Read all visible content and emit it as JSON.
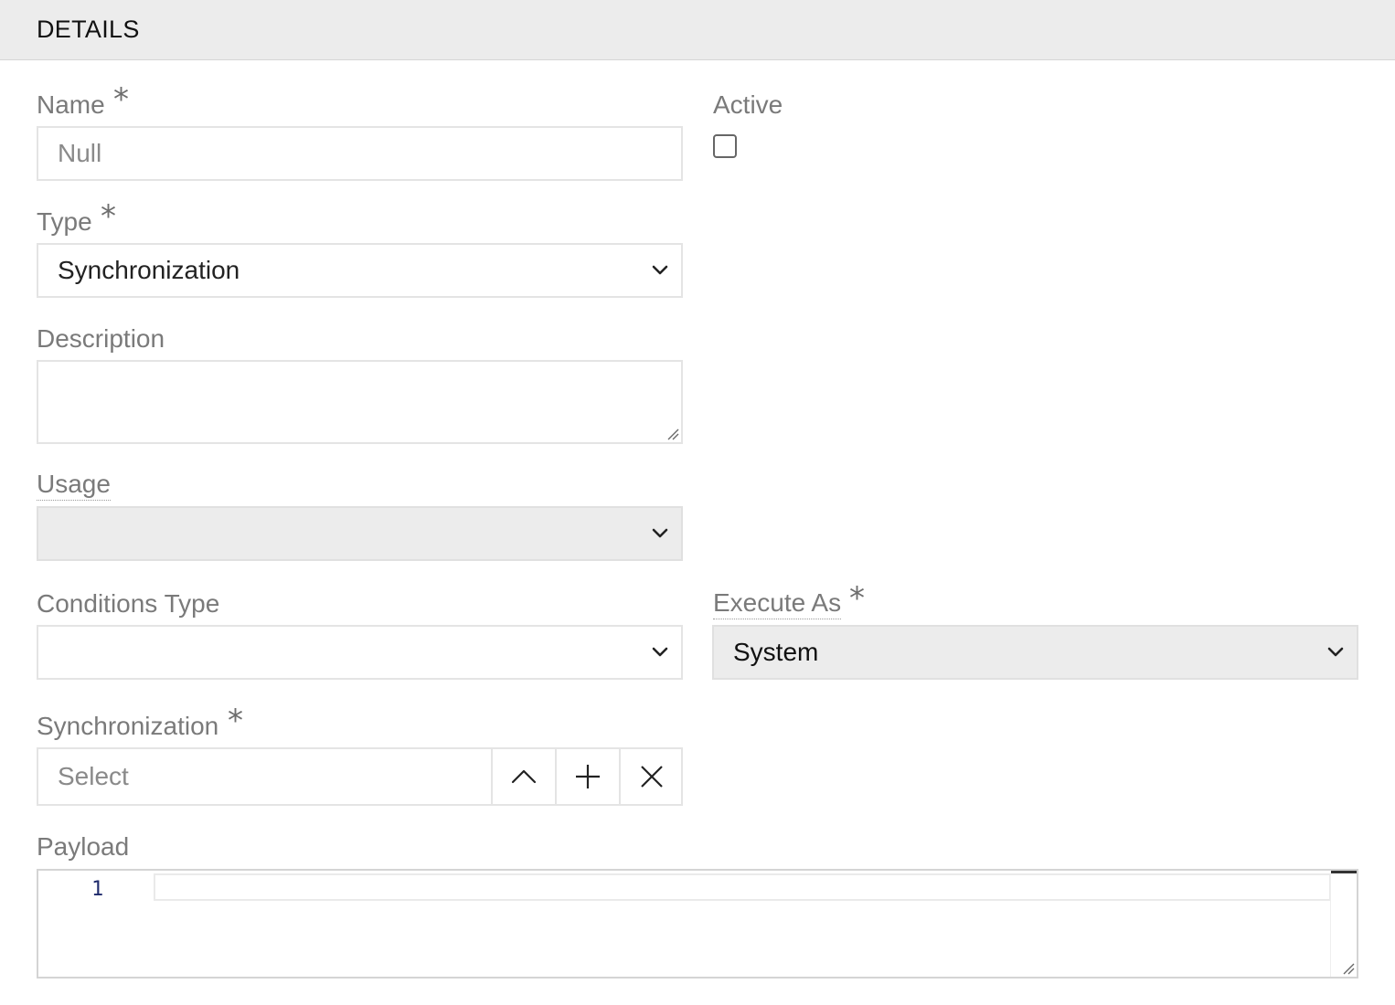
{
  "header": {
    "title": "DETAILS"
  },
  "fields": {
    "name": {
      "label": "Name",
      "required_mark": "*",
      "placeholder": "Null",
      "value": ""
    },
    "active": {
      "label": "Active",
      "checked": false
    },
    "type": {
      "label": "Type",
      "required_mark": "*",
      "selected": "Synchronization"
    },
    "description": {
      "label": "Description",
      "value": ""
    },
    "usage": {
      "label": "Usage",
      "selected": ""
    },
    "conditions_type": {
      "label": "Conditions Type",
      "selected": ""
    },
    "execute_as": {
      "label": "Execute As",
      "required_mark": "*",
      "selected": "System"
    },
    "synchronization": {
      "label": "Synchronization",
      "required_mark": "*",
      "placeholder": "Select"
    },
    "payload": {
      "label": "Payload",
      "line_number": "1"
    }
  },
  "icons": {
    "dropdown": "chevron-down-icon",
    "expand": "chevron-up-icon",
    "add": "plus-icon",
    "clear": "close-icon",
    "resize": "resize-handle-icon"
  },
  "colors": {
    "header_bg": "#ececec",
    "label": "#7a7a7a",
    "field_border": "#e4e4e4",
    "disabled_bg": "#ececec",
    "line_number": "#1e2a6b"
  }
}
